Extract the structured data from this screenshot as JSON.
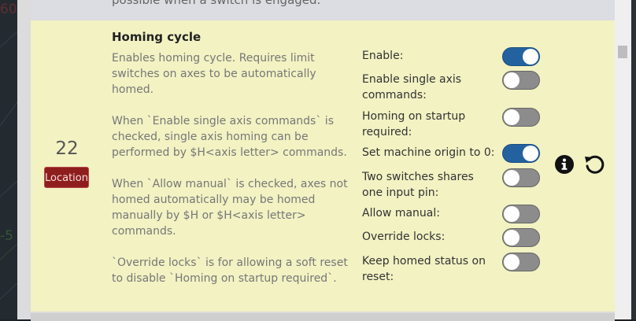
{
  "background": {
    "glyph_top": "60",
    "glyph_mid": "-5"
  },
  "prev_row": {
    "text": "possible when a switch is engaged."
  },
  "setting": {
    "id": "22",
    "badge": "Location",
    "title": "Homing cycle",
    "description": [
      "Enables homing cycle. Requires limit switches on axes to be automatically homed.",
      "When `Enable single axis commands` is checked, single axis homing can be performed by $H<axis letter> commands.",
      "When `Allow manual` is checked, axes not homed automatically may be homed manually by $H or $H<axis letter> commands.",
      "`Override locks` is for allowing a soft reset to disable `Homing on startup required`."
    ],
    "options": [
      {
        "label": "Enable:",
        "checked": true
      },
      {
        "label": "Enable single axis commands:",
        "checked": false
      },
      {
        "label": "Homing on startup required:",
        "checked": false
      },
      {
        "label": "Set machine origin to 0:",
        "checked": true
      },
      {
        "label": "Two switches shares one input pin:",
        "checked": false
      },
      {
        "label": "Allow manual:",
        "checked": false
      },
      {
        "label": "Override locks:",
        "checked": false
      },
      {
        "label": "Keep homed status on reset:",
        "checked": false
      }
    ]
  },
  "icons": {
    "info": "info-circle-icon",
    "reset": "undo-icon"
  },
  "colors": {
    "row_bg": "#f2f2c3",
    "toggle_on": "#23629f",
    "toggle_off": "#8c8c8c",
    "badge": "#8f1d1d"
  }
}
